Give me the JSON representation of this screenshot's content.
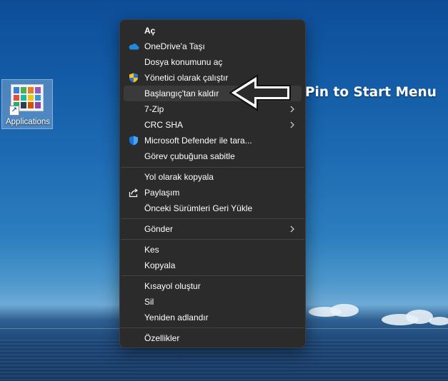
{
  "desktop": {
    "icon_label": "Applications"
  },
  "context_menu": {
    "items": {
      "open": "Aç",
      "move_onedrive": "OneDrive'a Taşı",
      "open_location": "Dosya konumunu aç",
      "run_admin": "Yönetici olarak çalıştır",
      "unpin_start": "Başlangıç'tan kaldır",
      "seven_zip": "7-Zip",
      "crc_sha": "CRC SHA",
      "defender_scan": "Microsoft Defender ile tara...",
      "pin_taskbar": "Görev çubuğuna sabitle",
      "copy_path": "Yol olarak kopyala",
      "share": "Paylaşım",
      "restore_versions": "Önceki Sürümleri Geri Yükle",
      "send_to": "Gönder",
      "cut": "Kes",
      "copy": "Kopyala",
      "create_shortcut": "Kısayol oluştur",
      "delete": "Sil",
      "rename": "Yeniden adlandır",
      "properties": "Özellikler"
    },
    "hovered_item": "unpin_start"
  },
  "annotation": {
    "text": "Pin to Start Menu"
  },
  "colors": {
    "menu_bg": "#2b2b2b",
    "menu_hover": "#3a3a3a",
    "separator": "#444444",
    "menu_text": "#ffffff",
    "onedrive_blue": "#1f8ae0",
    "defender_blue": "#1a73d9"
  },
  "icons": {
    "onedrive": "cloud-icon",
    "admin": "uac-shield-icon",
    "defender": "defender-shield-icon",
    "share": "share-icon",
    "submenu": "chevron-right-icon",
    "shortcut_overlay": "shortcut-arrow-icon"
  }
}
